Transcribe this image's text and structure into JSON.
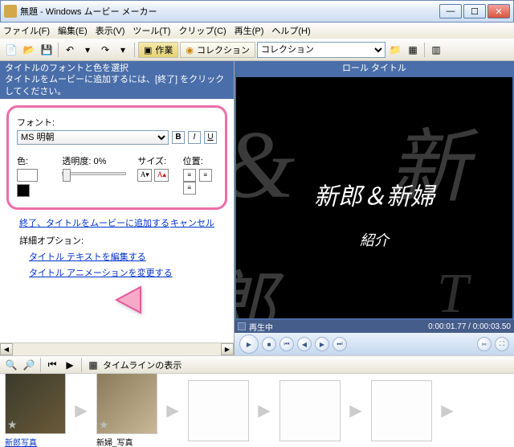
{
  "window": {
    "title": "無題 - Windows ムービー メーカー"
  },
  "menu": {
    "file": "ファイル(F)",
    "edit": "編集(E)",
    "view": "表示(V)",
    "tool": "ツール(T)",
    "clip": "クリップ(C)",
    "play": "再生(P)",
    "help": "ヘルプ(H)"
  },
  "toolbar": {
    "task_label": "作業",
    "collection_label": "コレクション",
    "collection_value": "コレクション"
  },
  "bluehead": {
    "line1": "タイトルのフォントと色を選択",
    "line2": "タイトルをムービーに追加するには、[終了] をクリックしてください。"
  },
  "panel": {
    "font_label": "フォント:",
    "font_value": "MS 明朝",
    "color_label": "色:",
    "trans_label": "透明度:",
    "trans_value": "0%",
    "size_label": "サイズ:",
    "pos_label": "位置:"
  },
  "links": {
    "done": "終了、タイトルをムービーに追加する",
    "cancel": "キャンセル",
    "opts_title": "詳細オプション:",
    "edit_text": "タイトル テキストを編集する",
    "edit_anim": "タイトル アニメーションを変更する"
  },
  "preview": {
    "heading": "ロール タイトル",
    "line1": "新郎＆新婦",
    "line2": "紹介",
    "status": "再生中",
    "time": "0:00:01.77 / 0:00:03.50"
  },
  "timeline": {
    "toolbar_text": "タイムラインの表示",
    "clip1": "新郎写真",
    "clip2": "新婦_写真"
  }
}
